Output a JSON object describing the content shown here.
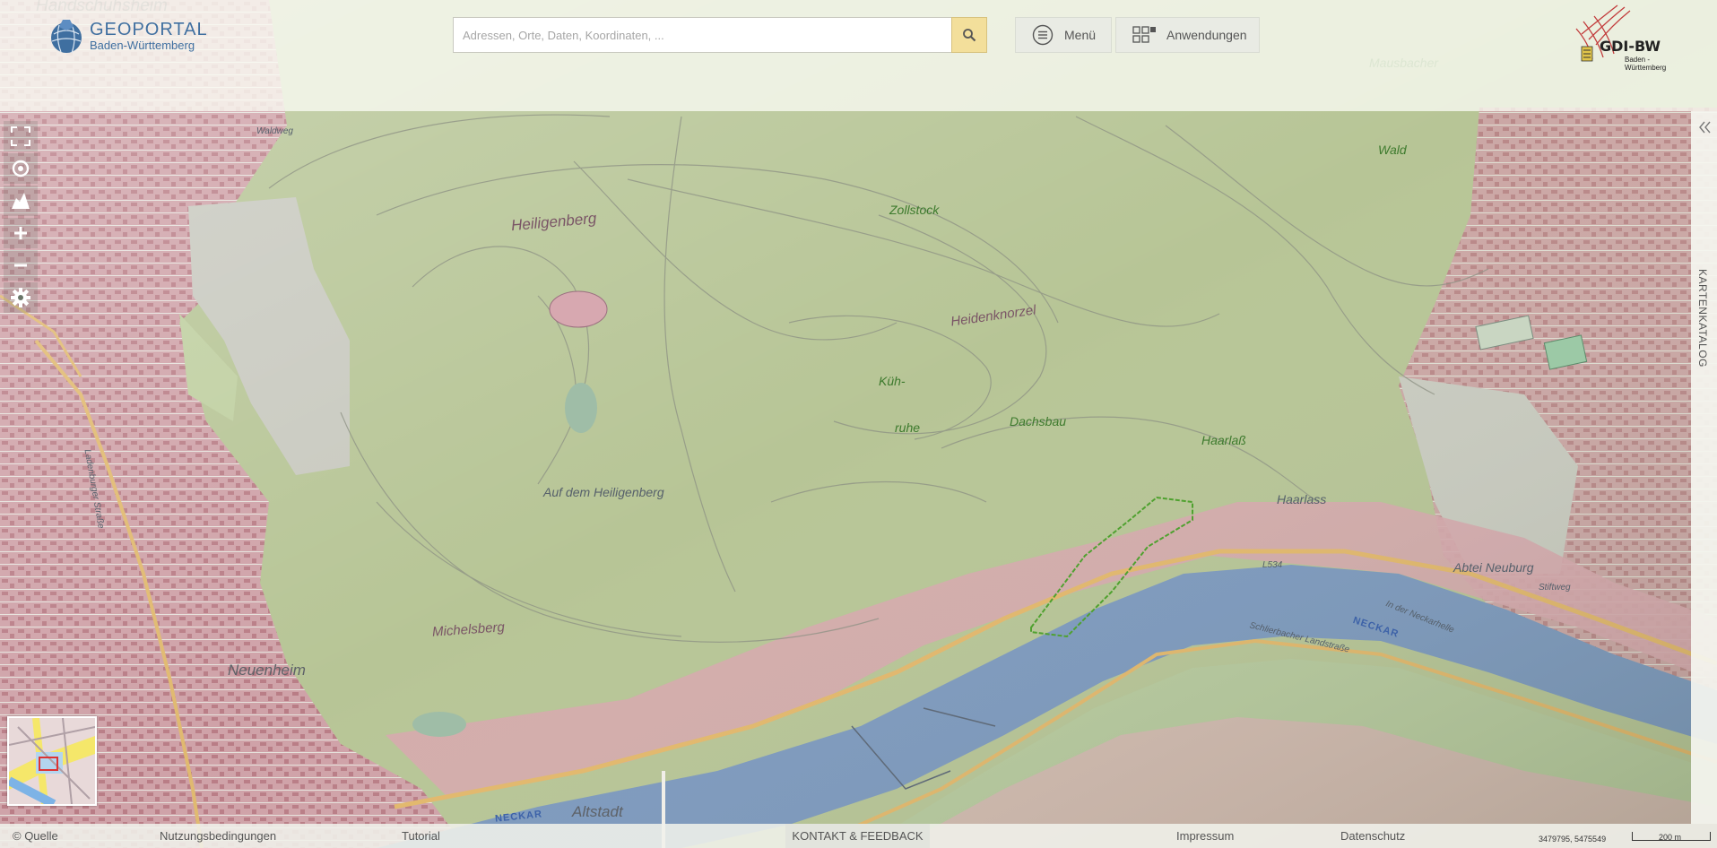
{
  "header": {
    "logo_title": "GEOPORTAL",
    "logo_subtitle": "Baden-Württemberg",
    "search_placeholder": "Adressen, Orte, Daten, Koordinaten, ...",
    "search_value": "",
    "menu_label": "Menü",
    "apps_label": "Anwendungen",
    "partner_logo_text": "GDI-BW",
    "partner_logo_sub": "Baden - Württemberg"
  },
  "map_tools": {
    "fullscreen": "fullscreen-icon",
    "locate": "locate-icon",
    "tilt": "3d-view-icon",
    "zoom_in": "zoom-in-icon",
    "zoom_out": "zoom-out-icon",
    "settings": "gear-icon"
  },
  "catalog": {
    "label": "KARTENKATALOG"
  },
  "map": {
    "labels": {
      "handschuhsheim": "Handschuhsheim",
      "heiligenberg": "Heiligenberg",
      "zollstock": "Zollstock",
      "heidenknorzel": "Heidenknorzel",
      "kuhruhe_1": "Küh-",
      "kuhruhe_2": "ruhe",
      "dachsbau": "Dachsbau",
      "auf_dem_heiligenberg": "Auf dem Heiligenberg",
      "michelsberg": "Michelsberg",
      "neuenheim": "Neuenheim",
      "altstadt": "Altstadt",
      "haarlass_forest": "Haarlaß",
      "haarlass": "Haarlass",
      "abtei_neuburg": "Abtei Neuburg",
      "wald": "Wald",
      "mausbacher": "Mausbacher",
      "neckar_1": "NECKAR",
      "neckar_2": "NECKAR",
      "in_der_neckarhelle": "In der Neckarhelle",
      "l534": "L534",
      "schlierbacher_landstrasse": "Schlierbacher Landstraße",
      "stiftweg": "Stiftweg",
      "waldweg": "Waldweg",
      "ladenburger": "Ladenburger Straße"
    },
    "colors": {
      "forest": "#b7c596",
      "settlement": "#d9a4ab",
      "river": "#7b98bd",
      "road_major": "#e3b86b",
      "fields": "#c5c8bd"
    }
  },
  "footer": {
    "source": "© Quelle",
    "terms": "Nutzungsbedingungen",
    "tutorial": "Tutorial",
    "feedback": "KONTAKT & FEEDBACK",
    "imprint": "Impressum",
    "privacy": "Datenschutz",
    "coordinates": "3479795, 5475549",
    "scale": "200 m"
  }
}
